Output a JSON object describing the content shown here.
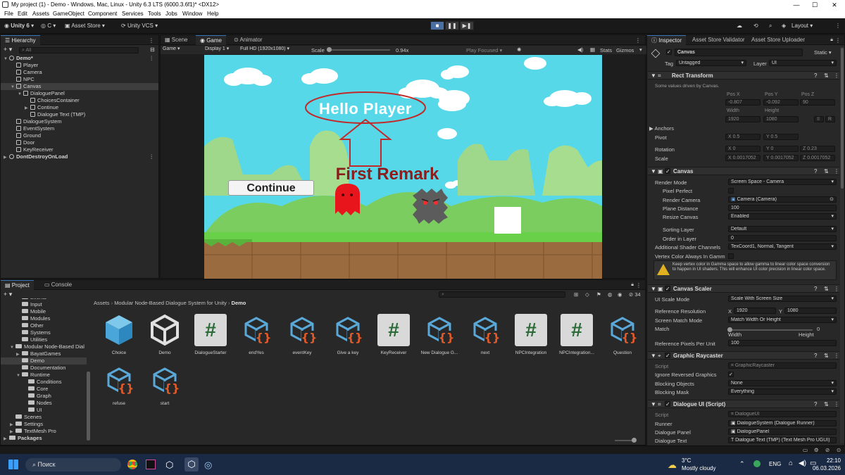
{
  "window": {
    "title": "My project (1) - Demo - Windows, Mac, Linux - Unity 6.3 LTS (6000.3.6f1)* <DX12>"
  },
  "menu": [
    "File",
    "Edit",
    "Assets",
    "GameObject",
    "Component",
    "Services",
    "Tools",
    "Jobs",
    "Window",
    "Help"
  ],
  "toolbar": {
    "account": "Unity 6",
    "cloud": "C",
    "asset_store": "Asset Store",
    "vcs": "Unity VCS",
    "layout": "Layout"
  },
  "hierarchy": {
    "tab": "Hierarchy",
    "search": "All",
    "items": [
      {
        "label": "Demo*",
        "depth": 0,
        "arrow": "▼",
        "type": "scene"
      },
      {
        "label": "Player",
        "depth": 1,
        "arrow": "",
        "type": "go"
      },
      {
        "label": "Camera",
        "depth": 1,
        "arrow": "",
        "type": "go"
      },
      {
        "label": "NPC",
        "depth": 1,
        "arrow": "",
        "type": "go"
      },
      {
        "label": "Canvas",
        "depth": 1,
        "arrow": "▼",
        "type": "go",
        "selected": true
      },
      {
        "label": "DialoguePanel",
        "depth": 2,
        "arrow": "▼",
        "type": "go"
      },
      {
        "label": "ChoicesContainer",
        "depth": 3,
        "arrow": "",
        "type": "go"
      },
      {
        "label": "Continue",
        "depth": 3,
        "arrow": "▶",
        "type": "go"
      },
      {
        "label": "Dialogue Text (TMP)",
        "depth": 3,
        "arrow": "",
        "type": "go"
      },
      {
        "label": "DialogueSystem",
        "depth": 1,
        "arrow": "",
        "type": "go"
      },
      {
        "label": "EventSystem",
        "depth": 1,
        "arrow": "",
        "type": "go"
      },
      {
        "label": "Ground",
        "depth": 1,
        "arrow": "",
        "type": "go"
      },
      {
        "label": "Door",
        "depth": 1,
        "arrow": "",
        "type": "go"
      },
      {
        "label": "KeyReceiver",
        "depth": 1,
        "arrow": "",
        "type": "go"
      },
      {
        "label": "DontDestroyOnLoad",
        "depth": 0,
        "arrow": "▶",
        "type": "scene"
      }
    ]
  },
  "game_view": {
    "tabs": [
      "Scene",
      "Game",
      "Animator"
    ],
    "display_mode": "Game",
    "display": "Display 1",
    "resolution": "Full HD (1920x1080)",
    "scale_label": "Scale",
    "scale_value": "0.94x",
    "play_focused": "Play Focused",
    "stats": "Stats",
    "gizmos": "Gizmos",
    "bubble_text": "Hello Player",
    "remark_text": "First Remark",
    "continue_text": "Continue"
  },
  "inspector": {
    "tabs": [
      "Inspector",
      "Asset Store Validator",
      "Asset Store Uploader"
    ],
    "object_name": "Canvas",
    "static": "Static",
    "tag_label": "Tag",
    "tag": "Untagged",
    "layer_label": "Layer",
    "layer": "UI",
    "rect_transform": {
      "title": "Rect Transform",
      "note": "Some values driven by Canvas.",
      "pos_x_label": "Pos X",
      "pos_y_label": "Pos Y",
      "pos_z_label": "Pos Z",
      "pos_x": "-0.807",
      "pos_y": "-0.092",
      "pos_z": "90",
      "width_label": "Width",
      "height_label": "Height",
      "width": "1920",
      "height": "1080",
      "anchors": "Anchors",
      "pivot": "Pivot",
      "pivot_x": "X 0.5",
      "pivot_y": "Y 0.5",
      "rotation": "Rotation",
      "rot_x": "X  0",
      "rot_y": "Y  0",
      "rot_z": "Z  0.23",
      "scale": "Scale",
      "scale_x": "X  0.0017052",
      "scale_y": "Y  0.0017052",
      "scale_z": "Z  0.0017052",
      "r": "R"
    },
    "canvas": {
      "title": "Canvas",
      "rows": [
        {
          "label": "Render Mode",
          "value": "Screen Space - Camera",
          "kind": "dropdown",
          "indent": false
        },
        {
          "label": "Pixel Perfect",
          "value": "",
          "kind": "check",
          "indent": true
        },
        {
          "label": "Render Camera",
          "value": "Camera (Camera)",
          "kind": "object",
          "indent": true
        },
        {
          "label": "Plane Distance",
          "value": "100",
          "kind": "field",
          "indent": true
        },
        {
          "label": "Resize Canvas",
          "value": "Enabled",
          "kind": "dropdown",
          "indent": true
        },
        {
          "label": "Sorting Layer",
          "value": "Default",
          "kind": "dropdown",
          "indent": true
        },
        {
          "label": "Order in Layer",
          "value": "0",
          "kind": "field",
          "indent": true
        },
        {
          "label": "Additional Shader Channels",
          "value": "TexCoord1, Normal, Tangent",
          "kind": "dropdown",
          "indent": false
        },
        {
          "label": "Vertex Color Always In Gamm",
          "value": "",
          "kind": "check",
          "indent": false
        }
      ],
      "warning": "Keep vertex color in Gamma space to allow gamma to linear color space conversion to happen in UI shaders. This will enhance UI color precision in linear color space."
    },
    "canvas_scaler": {
      "title": "Canvas Scaler",
      "ui_scale_label": "UI Scale Mode",
      "ui_scale": "Scale With Screen Size",
      "ref_res_label": "Reference Resolution",
      "ref_x": "1920",
      "ref_y": "1080",
      "match_mode_label": "Screen Match Mode",
      "match_mode": "Match Width Or Height",
      "match_label": "Match",
      "match_value": "0",
      "width_label": "Width",
      "height_label": "Height",
      "ppu_label": "Reference Pixels Per Unit",
      "ppu": "100"
    },
    "graphic_raycaster": {
      "title": "Graphic Raycaster",
      "script_label": "Script",
      "script": "GraphicRaycaster",
      "ignore_label": "Ignore Reversed Graphics",
      "blocking_label": "Blocking Objects",
      "blocking": "None",
      "mask_label": "Blocking Mask",
      "mask": "Everything"
    },
    "dialogue_ui": {
      "title": "Dialogue UI (Script)",
      "script_label": "Script",
      "script": "DialogueUI",
      "runner_label": "Runner",
      "runner": "DialogueSystem (Dialogue Runner)",
      "panel_label": "Dialogue Panel",
      "panel": "DialoguePanel",
      "text_label": "Dialogue Text",
      "text": "Dialogue Text (TMP) (Text Mesh Pro UGUI)"
    }
  },
  "project": {
    "tabs": [
      "Project",
      "Console"
    ],
    "breadcrumb": [
      "Assets",
      "Modular Node-Based Dialogue System for Unity",
      "Demo"
    ],
    "badge": "34",
    "folders": [
      {
        "label": "Events",
        "depth": 2
      },
      {
        "label": "Input",
        "depth": 2
      },
      {
        "label": "Mobile",
        "depth": 2
      },
      {
        "label": "Modules",
        "depth": 2
      },
      {
        "label": "Other",
        "depth": 2
      },
      {
        "label": "Systems",
        "depth": 2
      },
      {
        "label": "Utilities",
        "depth": 2
      },
      {
        "label": "Modular Node-Based Dial",
        "depth": 1,
        "arrow": "▼"
      },
      {
        "label": "BayatGames",
        "depth": 2,
        "arrow": "▶"
      },
      {
        "label": "Demo",
        "depth": 2,
        "selected": true
      },
      {
        "label": "Documentation",
        "depth": 2
      },
      {
        "label": "Runtime",
        "depth": 2,
        "arrow": "▼"
      },
      {
        "label": "Conditions",
        "depth": 3
      },
      {
        "label": "Core",
        "depth": 3
      },
      {
        "label": "Graph",
        "depth": 3
      },
      {
        "label": "Nodes",
        "depth": 3
      },
      {
        "label": "UI",
        "depth": 3
      },
      {
        "label": "Scenes",
        "depth": 1
      },
      {
        "label": "Settings",
        "depth": 1,
        "arrow": "▶"
      },
      {
        "label": "TextMesh Pro",
        "depth": 1,
        "arrow": "▶"
      },
      {
        "label": "Packages",
        "depth": 0,
        "arrow": "▶",
        "bold": true
      }
    ],
    "assets": [
      {
        "label": "Choice",
        "kind": "box"
      },
      {
        "label": "Demo",
        "kind": "unity"
      },
      {
        "label": "DialogueStarter",
        "kind": "script"
      },
      {
        "label": "endYes",
        "kind": "node"
      },
      {
        "label": "eventKey",
        "kind": "node"
      },
      {
        "label": "Give a key",
        "kind": "node"
      },
      {
        "label": "KeyReceiver",
        "kind": "script"
      },
      {
        "label": "New Dialogue G...",
        "kind": "node"
      },
      {
        "label": "next",
        "kind": "node"
      },
      {
        "label": "NPCIntegration",
        "kind": "script"
      },
      {
        "label": "NPCIntegration...",
        "kind": "script"
      },
      {
        "label": "Question",
        "kind": "node"
      },
      {
        "label": "refuse",
        "kind": "node"
      },
      {
        "label": "start",
        "kind": "node"
      }
    ]
  },
  "taskbar": {
    "search": "Поиск",
    "weather_temp": "3°C",
    "weather_desc": "Mostly cloudy",
    "lang": "ENG",
    "time": "22:10",
    "date": "06.03.2026"
  }
}
